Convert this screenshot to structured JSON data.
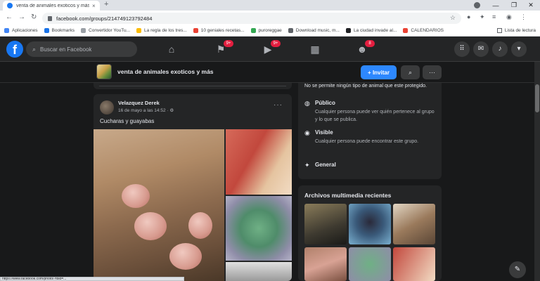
{
  "browser": {
    "tab_title": "venta de animales exoticos y más",
    "tab_close": "×",
    "new_tab": "+",
    "url": "facebook.com/groups/214749123792484",
    "bookmarks": [
      {
        "label": "Aplicaciones",
        "color": "#4285f4"
      },
      {
        "label": "Bookmarks",
        "color": "#1a73e8"
      },
      {
        "label": "Convertidor YouTu...",
        "color": "#9aa0a6"
      },
      {
        "label": "La regla de los tres...",
        "color": "#fbbc04"
      },
      {
        "label": "10 geniales recetas...",
        "color": "#ea4335"
      },
      {
        "label": "puroreggae",
        "color": "#34a853"
      },
      {
        "label": "Download music, m...",
        "color": "#5f6368"
      },
      {
        "label": "La ciudad invade al...",
        "color": "#202124"
      },
      {
        "label": "CALENDARIOS",
        "color": "#ea4335"
      }
    ],
    "reading_list": "Lista de lectura",
    "status_url": "https://www.facebook.com/photo/?fbid=..."
  },
  "facebook": {
    "search_placeholder": "Buscar en Facebook",
    "badges": {
      "pages": "9+",
      "watch": "9+",
      "groups": "8"
    }
  },
  "group": {
    "name": "venta de animales exoticos y más",
    "invite_label": "+ Invitar"
  },
  "post": {
    "author": "Velazquez Derek",
    "date": "16 de mayo a las 14:52 · ⚙",
    "text": "Cucharas  y guayabas"
  },
  "about": {
    "intro": "No se permite ningún tipo de animal que este protegido.",
    "public_title": "Público",
    "public_desc": "Cualquier persona puede ver quién pertenece al grupo y lo que se publica.",
    "visible_title": "Visible",
    "visible_desc": "Cualquier persona puede encontrar este grupo.",
    "general_title": "General"
  },
  "media": {
    "title": "Archivos multimedia recientes"
  }
}
